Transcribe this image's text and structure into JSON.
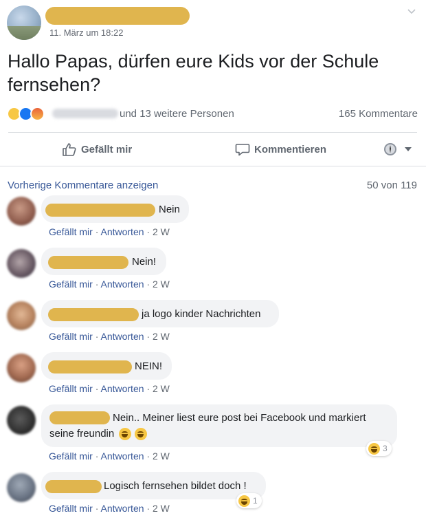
{
  "post": {
    "timestamp": "11. März um 18:22",
    "text": "Hallo Papas, dürfen eure Kids vor der Schule fernsehen?",
    "reaction_count_text": "und 13 weitere Personen",
    "comment_count_text": "165 Kommentare",
    "reaction_icons": [
      "haha-icon",
      "like-icon",
      "angry-icon"
    ]
  },
  "actions": {
    "like_label": "Gefällt mir",
    "comment_label": "Kommentieren"
  },
  "comments_header": {
    "previous_label": "Vorherige Kommentare anzeigen",
    "count_label": "50 von 119"
  },
  "comment_actions": {
    "like": "Gefällt mir",
    "reply": "Antworten",
    "age": "2 W",
    "sep": "·"
  },
  "comments": [
    {
      "text": "Nein"
    },
    {
      "text": "Nein!"
    },
    {
      "text": "ja logo kinder Nachrichten"
    },
    {
      "text": "NEIN!"
    },
    {
      "text": "Nein.. Meiner liest eure post bei Facebook und markiert",
      "text2": "seine freundin",
      "reaction_count": "3"
    },
    {
      "text": "Logisch fernsehen bildet doch !",
      "reaction_count": "1"
    }
  ],
  "colors": {
    "link": "#385898",
    "redaction": "#e0b54e",
    "bubble": "#f2f3f5"
  }
}
